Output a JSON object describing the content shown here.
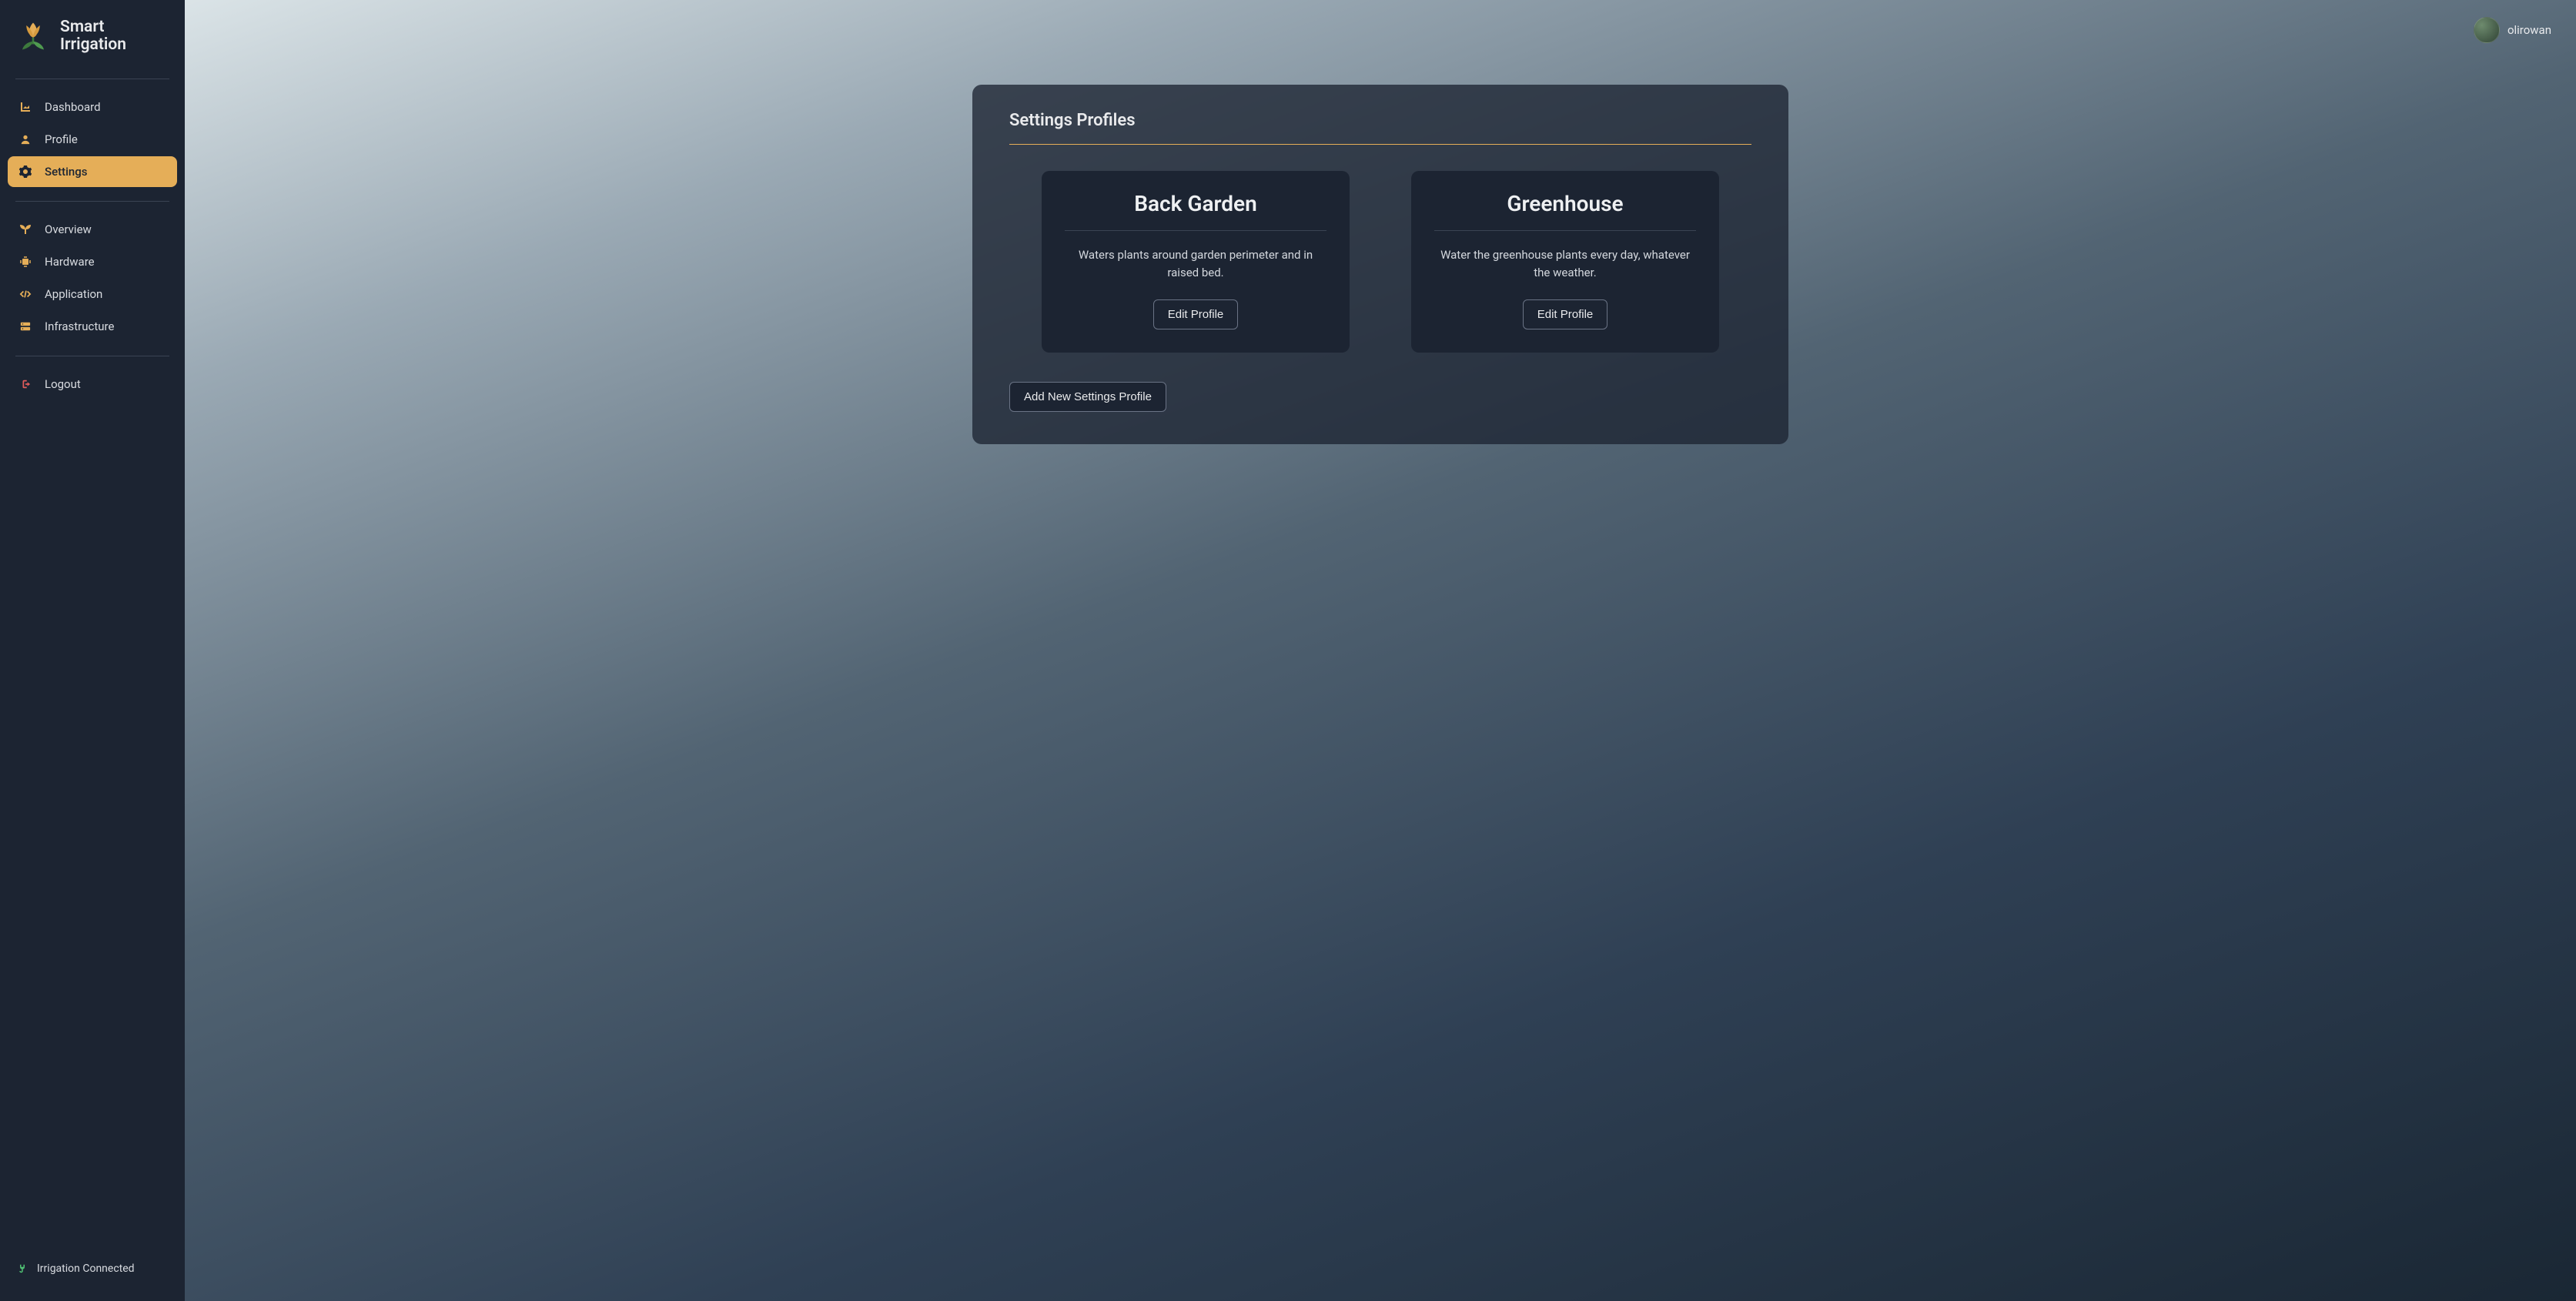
{
  "brand": {
    "title": "Smart\nIrrigation"
  },
  "sidebar": {
    "group1": {
      "dashboard": "Dashboard",
      "profile": "Profile",
      "settings": "Settings"
    },
    "group2": {
      "overview": "Overview",
      "hardware": "Hardware",
      "application": "Application",
      "infrastructure": "Infrastructure"
    },
    "logout": "Logout"
  },
  "status": {
    "text": "Irrigation Connected"
  },
  "user": {
    "name": "olirowan"
  },
  "panel": {
    "title": "Settings Profiles",
    "add_button": "Add New Settings Profile"
  },
  "profiles": [
    {
      "name": "Back Garden",
      "description": "Waters plants around garden perimeter and in raised bed.",
      "edit_label": "Edit Profile"
    },
    {
      "name": "Greenhouse",
      "description": "Water the greenhouse plants every day, whatever the weather.",
      "edit_label": "Edit Profile"
    }
  ],
  "colors": {
    "accent": "#e5ae58",
    "danger": "#e05b5b",
    "success": "#4fbf73"
  }
}
